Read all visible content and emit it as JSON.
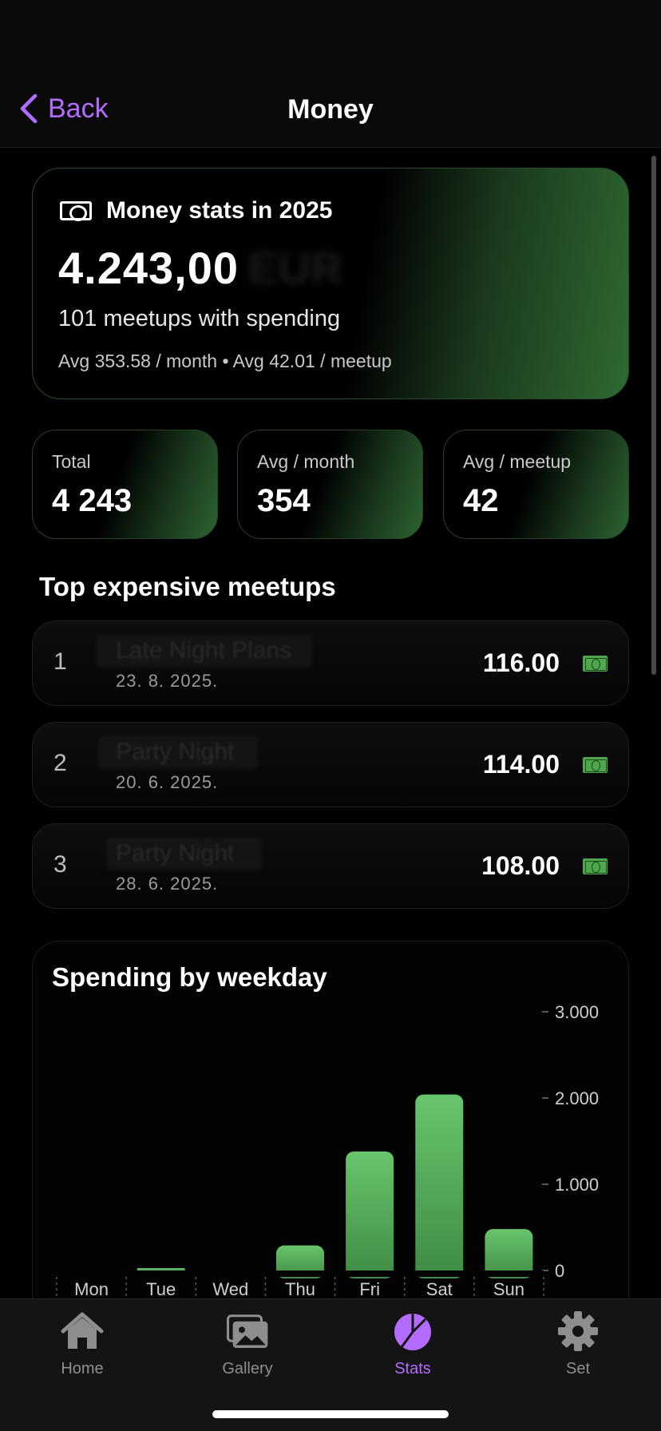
{
  "nav": {
    "back_label": "Back",
    "title": "Money"
  },
  "hero": {
    "title": "Money stats in 2025",
    "amount": "4.243,00",
    "currency": "EUR",
    "subtitle": "101 meetups with spending",
    "averages": "Avg 353.58 / month • Avg 42.01 / meetup"
  },
  "tiles": [
    {
      "label": "Total",
      "value": "4 243"
    },
    {
      "label": "Avg / month",
      "value": "354"
    },
    {
      "label": "Avg / meetup",
      "value": "42"
    }
  ],
  "top_section_title": "Top expensive meetups",
  "meetups": [
    {
      "rank": "1",
      "name": "Late Night Plans",
      "date": "23. 8. 2025.",
      "amount": "116.00"
    },
    {
      "rank": "2",
      "name": "Party Night",
      "date": "20. 6. 2025.",
      "amount": "114.00"
    },
    {
      "rank": "3",
      "name": "Party Night",
      "date": "28. 6. 2025.",
      "amount": "108.00"
    }
  ],
  "chart_data": {
    "type": "bar",
    "title": "Spending by weekday",
    "categories": [
      "Mon",
      "Tue",
      "Wed",
      "Thu",
      "Fri",
      "Sat",
      "Sun"
    ],
    "values": [
      0,
      25,
      0,
      290,
      1380,
      2040,
      480
    ],
    "ylim": [
      0,
      3000
    ],
    "yticks": [
      0,
      1000,
      2000,
      3000
    ],
    "ytick_labels": [
      "0",
      "1.000",
      "2.000",
      "3.000"
    ],
    "bar_color": "#5dbb63",
    "grid": false
  },
  "tabs": [
    {
      "label": "Home",
      "icon": "house-icon",
      "active": false
    },
    {
      "label": "Gallery",
      "icon": "photos-icon",
      "active": false
    },
    {
      "label": "Stats",
      "icon": "pie-chart-icon",
      "active": true
    },
    {
      "label": "Set",
      "icon": "gear-icon",
      "active": false
    }
  ],
  "colors": {
    "accent": "#b46cff",
    "green": "#5dbb63"
  }
}
